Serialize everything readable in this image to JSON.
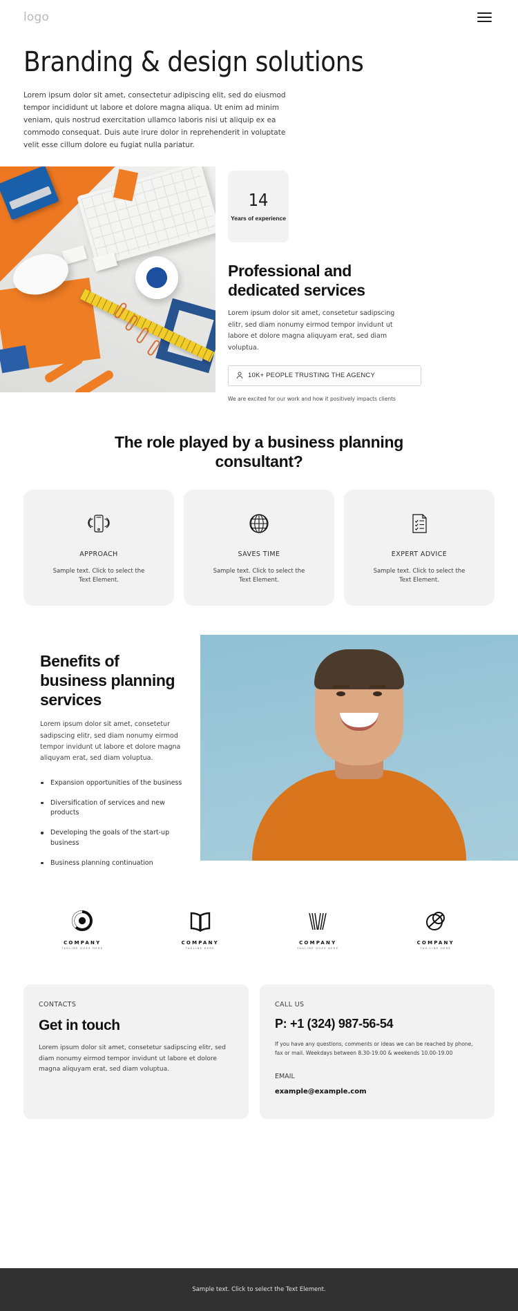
{
  "header": {
    "logo": "logo",
    "menu_icon": "hamburger-menu-icon"
  },
  "hero": {
    "title": "Branding & design solutions",
    "paragraph": "Lorem ipsum dolor sit amet, consectetur adipiscing elit, sed do eiusmod tempor incididunt ut labore et dolore magna aliqua. Ut enim ad minim veniam, quis nostrud exercitation ullamco laboris nisi ut aliquip ex ea commodo consequat. Duis aute irure dolor in reprehenderit in voluptate velit esse cillum dolore eu fugiat nulla pariatur."
  },
  "services": {
    "stat_number": "14",
    "stat_label": "Years of experience",
    "title": "Professional and dedicated services",
    "paragraph": "Lorem ipsum dolor sit amet, consetetur sadipscing elitr, sed diam nonumy eirmod tempor invidunt ut labore et dolore magna aliquyam erat, sed diam voluptua.",
    "trust_button": "10K+ PEOPLE TRUSTING THE AGENCY",
    "trust_note": "We are excited for our work and how it positively impacts clients"
  },
  "role": {
    "title": "The role played by a business planning consultant?",
    "cards": [
      {
        "icon": "mobile-signal-icon",
        "title": "APPROACH",
        "text": "Sample text. Click to select the Text Element."
      },
      {
        "icon": "globe-icon",
        "title": "SAVES TIME",
        "text": "Sample text. Click to select the Text Element."
      },
      {
        "icon": "checklist-document-icon",
        "title": "EXPERT ADVICE",
        "text": "Sample text. Click to select the Text Element."
      }
    ]
  },
  "benefits": {
    "title": "Benefits of business planning services",
    "paragraph": "Lorem ipsum dolor sit amet, consetetur sadipscing elitr, sed diam nonumy eirmod tempor invidunt ut labore et dolore magna aliquyam erat, sed diam voluptua.",
    "list": [
      "Expansion opportunities of the business",
      "Diversification of services and new products",
      "Developing the goals of the start-up business",
      "Business planning continuation"
    ]
  },
  "logos": [
    {
      "mark": "circle-o-logo-icon",
      "name": "COMPANY",
      "tagline": "TAGLINE GOES HERE"
    },
    {
      "mark": "open-book-logo-icon",
      "name": "COMPANY",
      "tagline": "TAGLINE HERE"
    },
    {
      "mark": "striped-w-logo-icon",
      "name": "COMPANY",
      "tagline": "TAGLINE GOES HERE"
    },
    {
      "mark": "overlapping-circles-logo-icon",
      "name": "COMPANY",
      "tagline": "TAG LINE HERE"
    }
  ],
  "contact": {
    "eyebrow": "CONTACTS",
    "title": "Get in touch",
    "paragraph": "Lorem ipsum dolor sit amet, consetetur sadipscing elitr, sed diam nonumy eirmod tempor invidunt ut labore et dolore magna aliquyam erat, sed diam voluptua.",
    "call_label": "CALL US",
    "phone": "P: +1 (324) 987-56-54",
    "hours": "If you have any questions, comments or ideas we can be reached by phone, fax or mail. Weekdays between 8.30-19.00 & weekends 10.00-19.00",
    "email_label": "EMAIL",
    "email": "example@example.com"
  },
  "footer": {
    "text": "Sample text. Click to select the Text Element."
  },
  "colors": {
    "surface": "#f2f2f2",
    "footer_bg": "#313131",
    "accent_orange": "#ef7d24",
    "accent_blue": "#27538f"
  }
}
